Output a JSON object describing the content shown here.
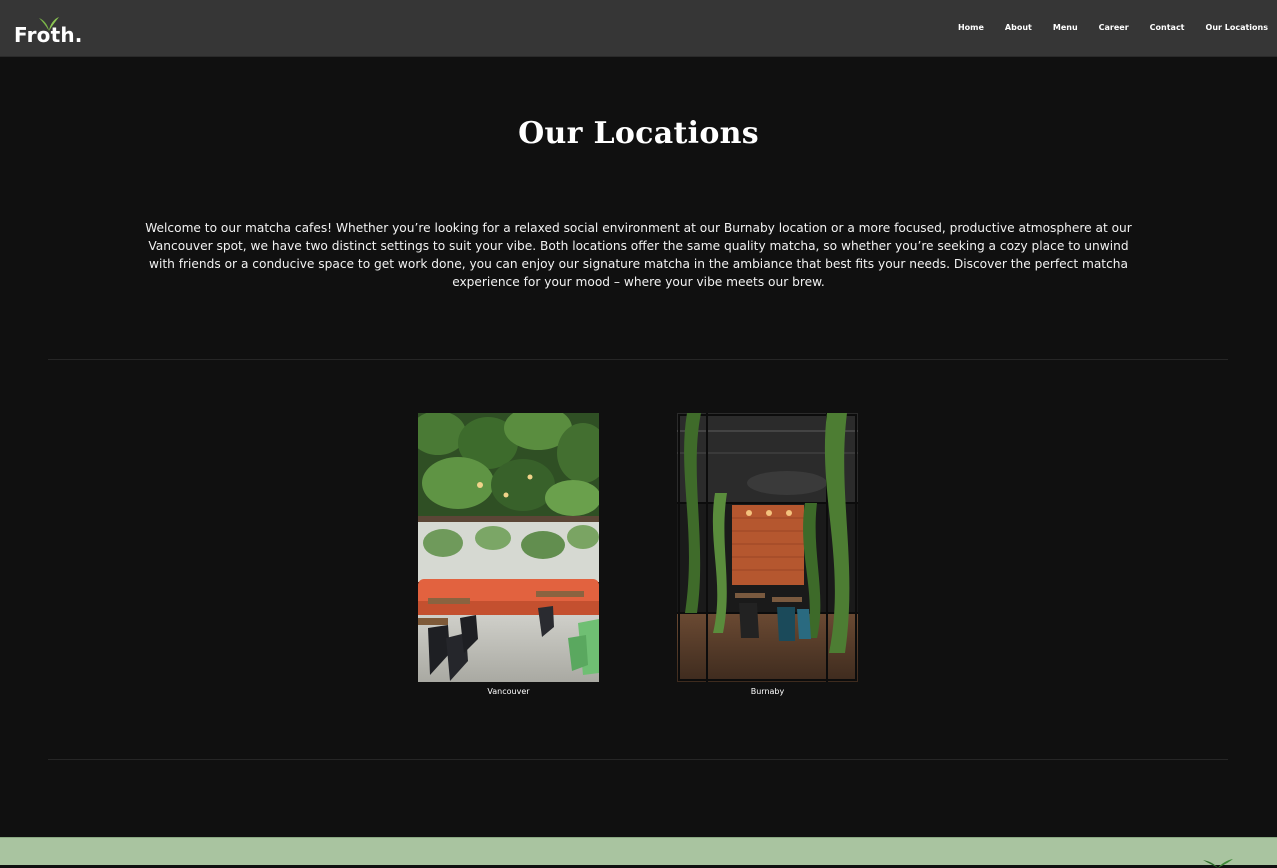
{
  "header": {
    "logo_text": "Froth.",
    "nav": [
      {
        "label": "Home"
      },
      {
        "label": "About"
      },
      {
        "label": "Menu"
      },
      {
        "label": "Career"
      },
      {
        "label": "Contact"
      },
      {
        "label": "Our Locations"
      }
    ]
  },
  "main": {
    "title": "Our Locations",
    "intro": "Welcome to our matcha cafes! Whether you’re looking for a relaxed social environment at our Burnaby location or a more focused, productive atmosphere at our Vancouver spot, we have two distinct settings to suit your vibe. Both locations offer the same quality matcha, so whether you’re seeking a cozy place to unwind with friends or a conducive space to get work done, you can enjoy our signature matcha in the ambiance that best fits your needs. Discover the perfect matcha experience for your mood – where your vibe meets our brew.",
    "locations": [
      {
        "label": "Vancouver"
      },
      {
        "label": "Burnaby"
      }
    ]
  },
  "colors": {
    "background": "#101010",
    "header": "#363636",
    "footer": "#a9c4a0",
    "leaf": "#7ab648"
  }
}
